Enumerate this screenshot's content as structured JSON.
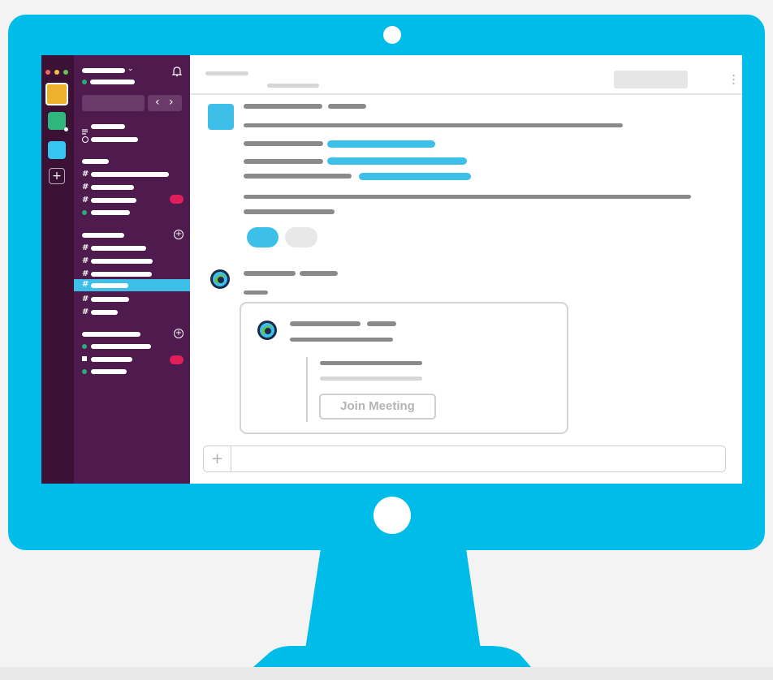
{
  "colors": {
    "monitor": "#00bce8",
    "workspace_rail": "#3b1236",
    "sidebar": "#4f1a4e",
    "accent_blue": "#3cc0ea",
    "unread_badge": "#e01e5a",
    "online_green": "#2bac76",
    "workspace_yellow": "#ecb22e",
    "workspace_green": "#2eb67d"
  },
  "icons": {
    "bell": "bell-icon",
    "add_workspace": "plus-icon",
    "attach": "plus-icon",
    "more": "vertical-dots-icon",
    "bot_avatar": "webex-logo-icon"
  },
  "sidebar": {
    "nav_prev": "‹",
    "nav_next": "›",
    "channel_symbol": "#",
    "add_section_symbol": "+"
  },
  "composer": {
    "attach_symbol": "+"
  },
  "meeting_card": {
    "join_label": "Join Meeting"
  }
}
